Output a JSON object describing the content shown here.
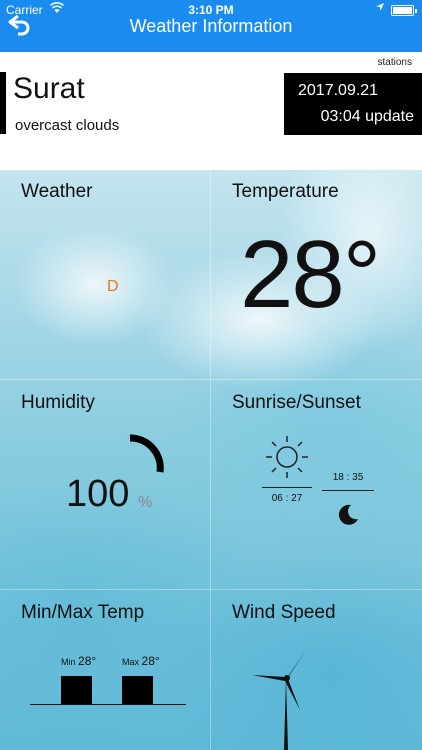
{
  "status_bar": {
    "carrier": "Carrier",
    "time": "3:10 PM"
  },
  "nav": {
    "title": "Weather Information",
    "back_icon": "back-arrow-icon"
  },
  "header": {
    "stations_label": "stations",
    "city": "Surat",
    "condition": "overcast clouds",
    "date": "2017.09.21",
    "update": "03:04 update"
  },
  "panels": {
    "weather": {
      "label": "Weather",
      "icon_glyph": "D"
    },
    "temperature": {
      "label": "Temperature",
      "value": "28°"
    },
    "humidity": {
      "label": "Humidity",
      "value": "100",
      "unit": "%",
      "level": 1.0
    },
    "sunrise_sunset": {
      "label": "Sunrise/Sunset",
      "sunrise": "06 : 27",
      "sunset": "18 : 35"
    },
    "minmax": {
      "label": "Min/Max Temp",
      "min_label": "Min",
      "min_value": "28°",
      "max_label": "Max",
      "max_value": "28°"
    },
    "wind": {
      "label": "Wind Speed"
    }
  },
  "colors": {
    "nav_bar": "#1a8cf0",
    "accent_orange": "#e07a1c"
  }
}
